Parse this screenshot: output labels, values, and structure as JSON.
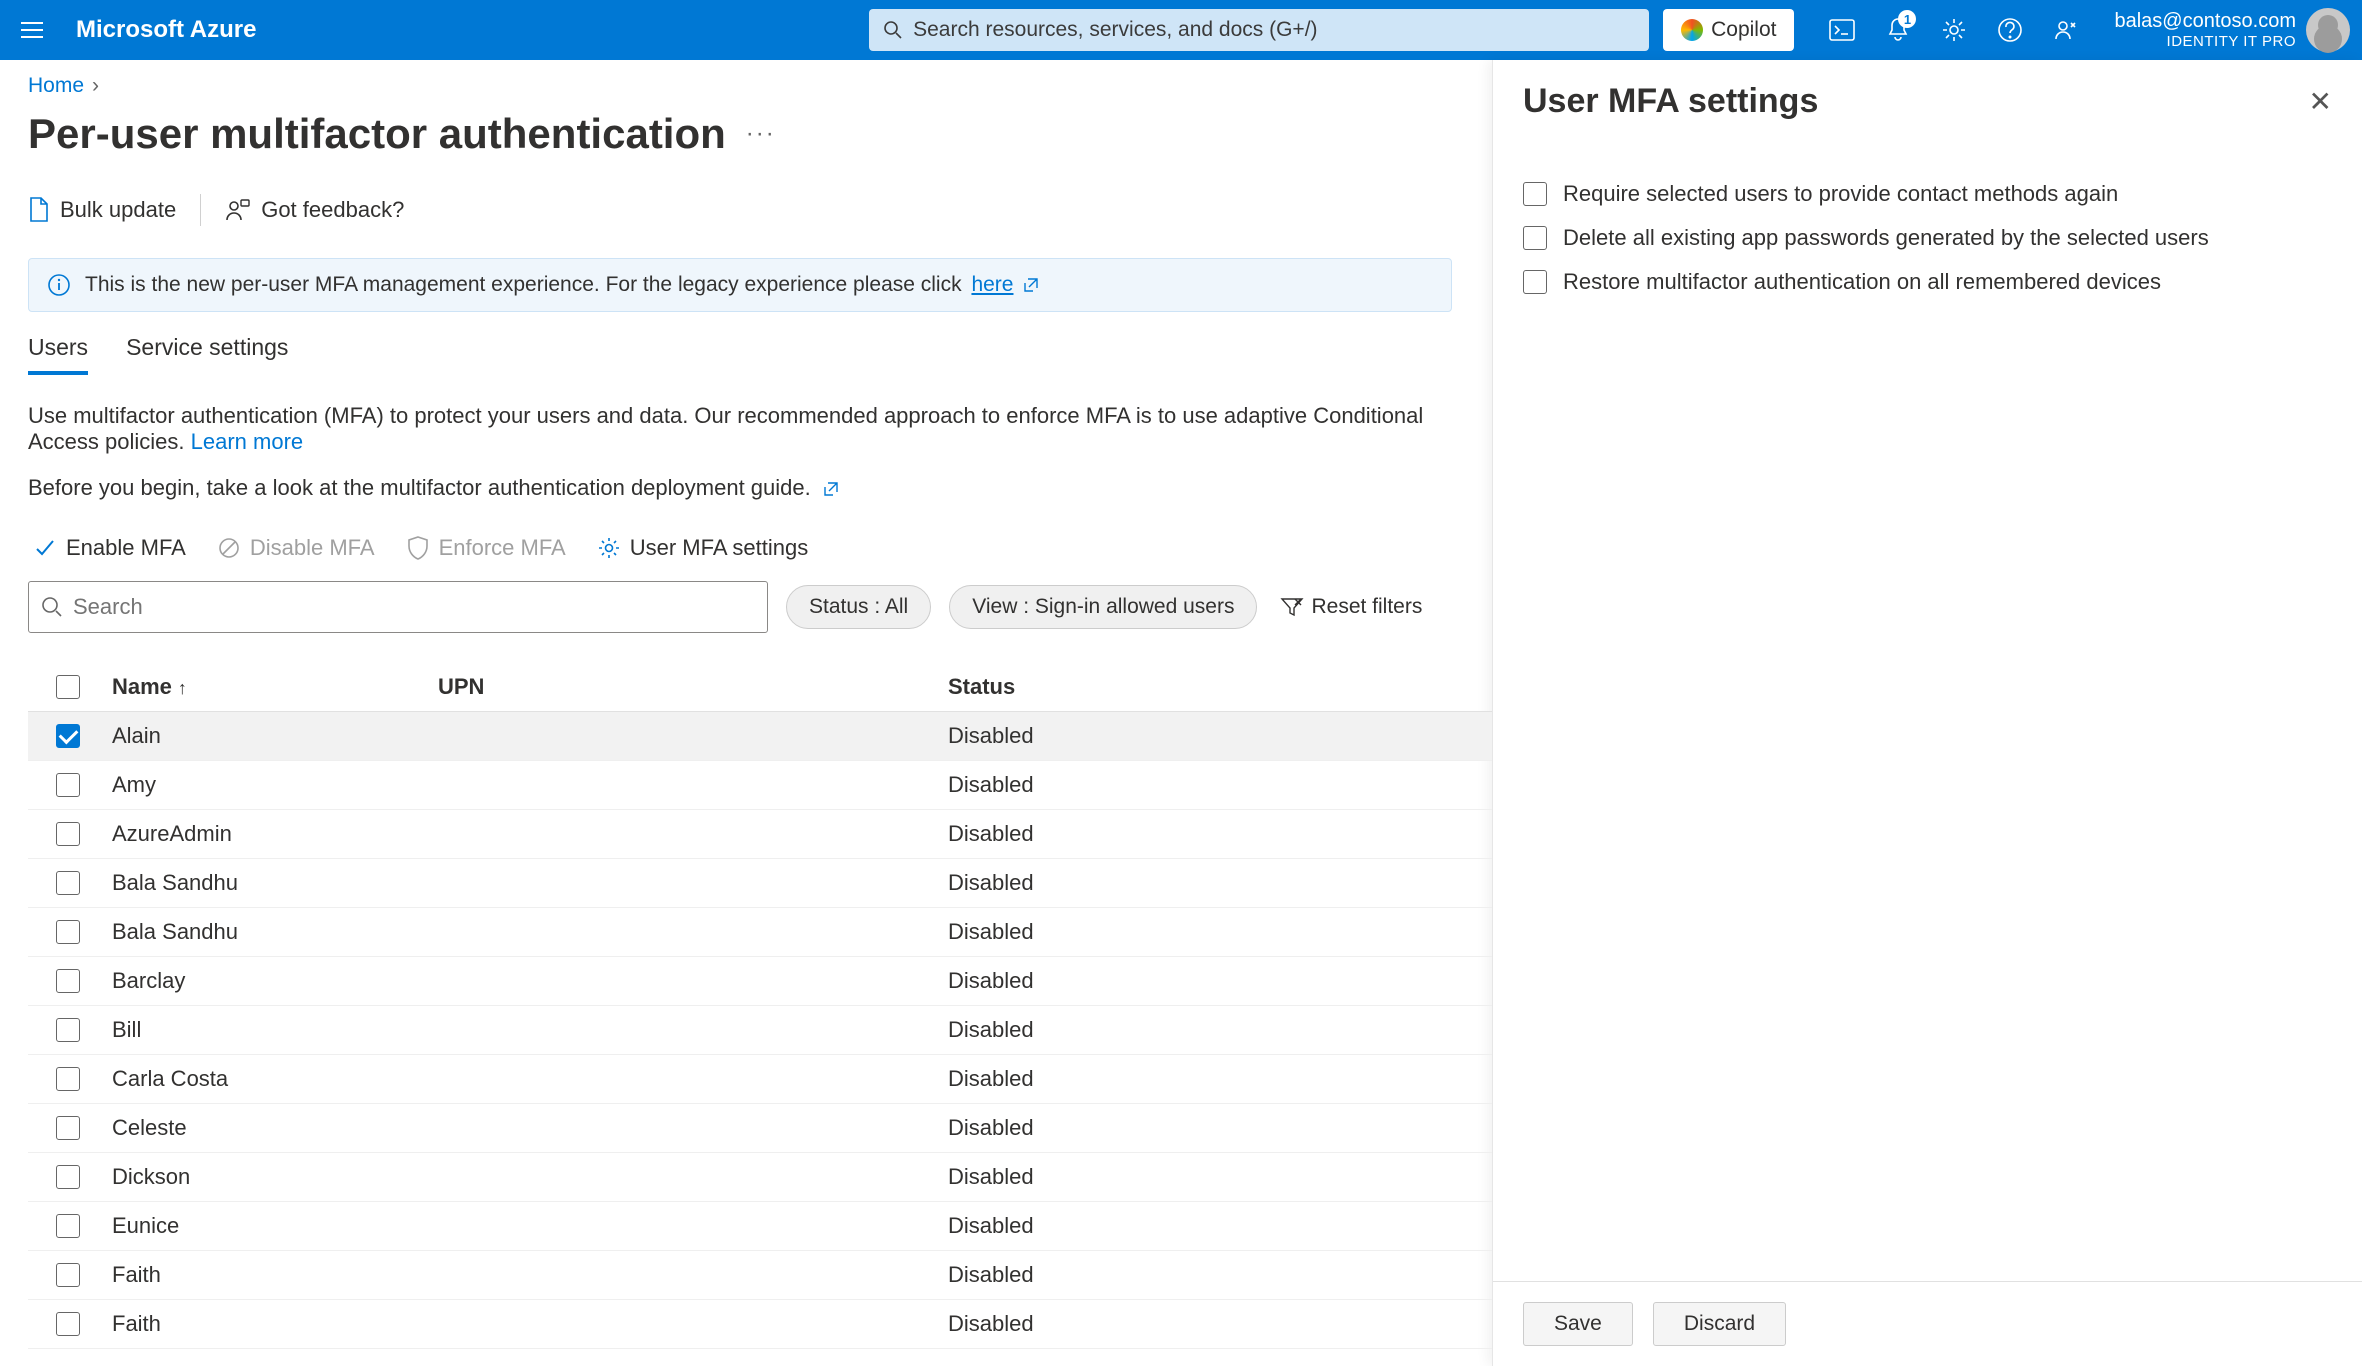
{
  "topbar": {
    "brand": "Microsoft Azure",
    "search_placeholder": "Search resources, services, and docs (G+/)",
    "copilot_label": "Copilot",
    "notification_count": "1",
    "account_email": "balas@contoso.com",
    "account_role": "IDENTITY IT PRO"
  },
  "breadcrumb": {
    "home": "Home"
  },
  "page": {
    "title": "Per-user multifactor authentication",
    "bulk_update": "Bulk update",
    "feedback": "Got feedback?",
    "banner_prefix": "This is the new per-user MFA management experience. For the legacy experience please click",
    "banner_link": "here"
  },
  "tabs": {
    "users": "Users",
    "service": "Service settings"
  },
  "desc": {
    "line1_a": "Use multifactor authentication (MFA) to protect your users and data. Our recommended approach to enforce MFA is to use adaptive Conditional Access policies. ",
    "learn_more": "Learn more",
    "line2_a": "Before you begin, take a look at the ",
    "deploy_guide": "multifactor authentication deployment guide."
  },
  "toolbar2": {
    "enable": "Enable MFA",
    "disable": "Disable MFA",
    "enforce": "Enforce MFA",
    "settings": "User MFA settings"
  },
  "filters": {
    "search_placeholder": "Search",
    "status": "Status : All",
    "view": "View : Sign-in allowed users",
    "reset": "Reset filters"
  },
  "table": {
    "headers": {
      "name": "Name",
      "upn": "UPN",
      "status": "Status"
    },
    "rows": [
      {
        "name": "Alain",
        "upn": "",
        "status": "Disabled",
        "checked": true
      },
      {
        "name": "Amy",
        "upn": "",
        "status": "Disabled",
        "checked": false
      },
      {
        "name": "AzureAdmin",
        "upn": "",
        "status": "Disabled",
        "checked": false
      },
      {
        "name": "Bala Sandhu",
        "upn": "",
        "status": "Disabled",
        "checked": false
      },
      {
        "name": "Bala Sandhu",
        "upn": "",
        "status": "Disabled",
        "checked": false
      },
      {
        "name": "Barclay",
        "upn": "",
        "status": "Disabled",
        "checked": false
      },
      {
        "name": "Bill",
        "upn": "",
        "status": "Disabled",
        "checked": false
      },
      {
        "name": "Carla Costa",
        "upn": "",
        "status": "Disabled",
        "checked": false
      },
      {
        "name": "Celeste",
        "upn": "",
        "status": "Disabled",
        "checked": false
      },
      {
        "name": "Dickson",
        "upn": "",
        "status": "Disabled",
        "checked": false
      },
      {
        "name": "Eunice",
        "upn": "",
        "status": "Disabled",
        "checked": false
      },
      {
        "name": "Faith",
        "upn": "",
        "status": "Disabled",
        "checked": false
      },
      {
        "name": "Faith",
        "upn": "",
        "status": "Disabled",
        "checked": false
      }
    ]
  },
  "panel": {
    "title": "User MFA settings",
    "opt1": "Require selected users to provide contact methods again",
    "opt2": "Delete all existing app passwords generated by the selected users",
    "opt3": "Restore multifactor authentication on all remembered devices",
    "save": "Save",
    "discard": "Discard"
  }
}
